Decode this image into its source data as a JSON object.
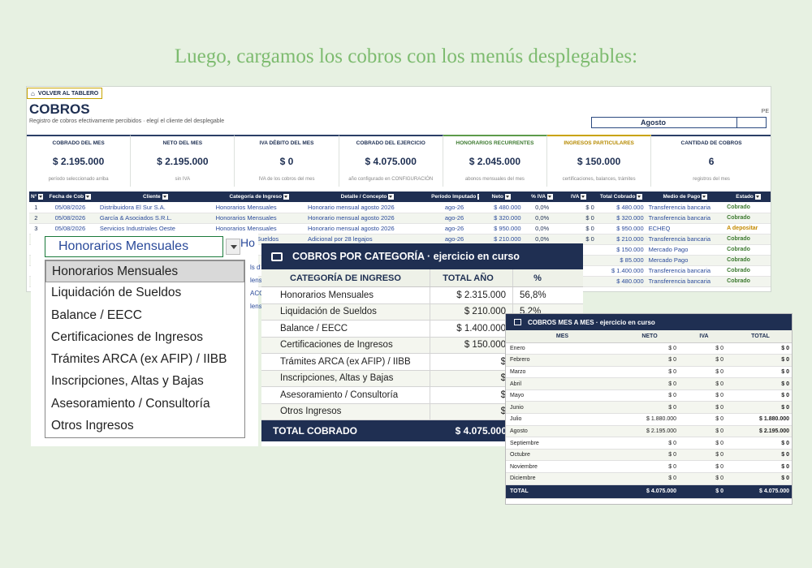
{
  "headline": "Luego, cargamos los cobros con los menús desplegables:",
  "sheet": {
    "back_label": "VOLVER AL TABLERO",
    "title": "COBROS",
    "subtitle": "Registro de cobros efectivamente percibidos  ·  elegí el cliente del desplegable",
    "period_label": "PE",
    "month": "Agosto"
  },
  "kpis": [
    {
      "label": "COBRADO DEL MES",
      "value": "$ 2.195.000",
      "sub": "período seleccionado arriba",
      "tone": "navy"
    },
    {
      "label": "NETO DEL MES",
      "value": "$ 2.195.000",
      "sub": "sin IVA",
      "tone": "navy"
    },
    {
      "label": "IVA DÉBITO DEL MES",
      "value": "$ 0",
      "sub": "IVA de los cobros del mes",
      "tone": "navy"
    },
    {
      "label": "COBRADO DEL EJERCICIO",
      "value": "$ 4.075.000",
      "sub": "año configurado en CONFIGURACIÓN",
      "tone": "navy"
    },
    {
      "label": "HONORARIOS RECURRENTES",
      "value": "$ 2.045.000",
      "sub": "abonos mensuales del mes",
      "tone": "green"
    },
    {
      "label": "INGRESOS PARTICULARES",
      "value": "$ 150.000",
      "sub": "certificaciones, balances, trámites",
      "tone": "gold"
    },
    {
      "label": "CANTIDAD DE COBROS",
      "value": "6",
      "sub": "registros del mes",
      "tone": "navy"
    }
  ],
  "table": {
    "headers": [
      "N°",
      "Fecha de Cob",
      "Cliente",
      "Categoría de Ingreso",
      "Detalle / Concepto",
      "Período Imputado",
      "Neto",
      "% IVA",
      "IVA",
      "Total Cobrado",
      "Medio de Pago",
      "Estado"
    ],
    "rows": [
      [
        "1",
        "05/08/2026",
        "Distribuidora El Sur S.A.",
        "Honorarios Mensuales",
        "Honorario mensual agosto 2026",
        "ago-26",
        "$ 480.000",
        "0,0%",
        "$ 0",
        "$ 480.000",
        "Transferencia bancaria",
        "Cobrado"
      ],
      [
        "2",
        "05/08/2026",
        "García & Asociados S.R.L.",
        "Honorarios Mensuales",
        "Honorario mensual agosto 2026",
        "ago-26",
        "$ 320.000",
        "0,0%",
        "$ 0",
        "$ 320.000",
        "Transferencia bancaria",
        "Cobrado"
      ],
      [
        "3",
        "05/08/2026",
        "Servicios Industriales Oeste",
        "Honorarios Mensuales",
        "Honorario mensual agosto 2026",
        "ago-26",
        "$ 950.000",
        "0,0%",
        "$ 0",
        "$ 950.000",
        "ECHEQ",
        "A depositar"
      ],
      [
        "4",
        "",
        "",
        "Liquidación de Sueldos",
        "Adicional por 28 legajos",
        "ago-26",
        "$ 210.000",
        "0,0%",
        "$ 0",
        "$ 210.000",
        "Transferencia bancaria",
        "Cobrado"
      ],
      [
        "5",
        "",
        "",
        "",
        "",
        "",
        "",
        "",
        "",
        "$ 150.000",
        "Mercado Pago",
        "Cobrado"
      ],
      [
        "6",
        "",
        "",
        "",
        "",
        "",
        "",
        "",
        "",
        "$ 85.000",
        "Mercado Pago",
        "Cobrado"
      ],
      [
        "7",
        "",
        "",
        "",
        "",
        "",
        "",
        "",
        "",
        "$ 1.400.000",
        "Transferencia bancaria",
        "Cobrado"
      ],
      [
        "8",
        "",
        "",
        "",
        "",
        "",
        "",
        "",
        "",
        "$ 480.000",
        "Transferencia bancaria",
        "Cobrado"
      ]
    ]
  },
  "dropdown": {
    "current": "Honorarios Mensuales",
    "peek": "Ho",
    "side_peeks": [
      "ls d",
      "lens",
      "ACC",
      "lens"
    ],
    "options": [
      "Honorarios Mensuales",
      "Liquidación de Sueldos",
      "Balance / EECC",
      "Certificaciones de Ingresos",
      "Trámites ARCA (ex AFIP) / IIBB",
      "Inscripciones, Altas y Bajas",
      "Asesoramiento / Consultoría",
      "Otros Ingresos"
    ]
  },
  "categoria": {
    "title": "COBROS POR CATEGORÍA  ·  ejercicio en curso",
    "col_categoria": "CATEGORÍA DE INGRESO",
    "col_total": "TOTAL AÑO",
    "col_pct": "%",
    "rows": [
      {
        "name": "Honorarios Mensuales",
        "total": "$ 2.315.000",
        "pct": "56,8%"
      },
      {
        "name": "Liquidación de Sueldos",
        "total": "$ 210.000",
        "pct": "5,2%"
      },
      {
        "name": "Balance / EECC",
        "total": "$ 1.400.000",
        "pct": ""
      },
      {
        "name": "Certificaciones de Ingresos",
        "total": "$ 150.000",
        "pct": ""
      },
      {
        "name": "Trámites ARCA (ex AFIP) / IIBB",
        "total": "$",
        "pct": ""
      },
      {
        "name": "Inscripciones, Altas y Bajas",
        "total": "$",
        "pct": ""
      },
      {
        "name": "Asesoramiento / Consultoría",
        "total": "$",
        "pct": ""
      },
      {
        "name": "Otros Ingresos",
        "total": "$",
        "pct": ""
      }
    ],
    "total_label": "TOTAL COBRADO",
    "total_value": "$ 4.075.000"
  },
  "mes": {
    "title": "COBROS MES A MES  ·  ejercicio en curso",
    "headers": [
      "MES",
      "NETO",
      "IVA",
      "TOTAL"
    ],
    "rows": [
      [
        "Enero",
        "$ 0",
        "$ 0",
        "$ 0"
      ],
      [
        "Febrero",
        "$ 0",
        "$ 0",
        "$ 0"
      ],
      [
        "Marzo",
        "$ 0",
        "$ 0",
        "$ 0"
      ],
      [
        "Abril",
        "$ 0",
        "$ 0",
        "$ 0"
      ],
      [
        "Mayo",
        "$ 0",
        "$ 0",
        "$ 0"
      ],
      [
        "Junio",
        "$ 0",
        "$ 0",
        "$ 0"
      ],
      [
        "Julio",
        "$ 1.880.000",
        "$ 0",
        "$ 1.880.000"
      ],
      [
        "Agosto",
        "$ 2.195.000",
        "$ 0",
        "$ 2.195.000"
      ],
      [
        "Septiembre",
        "$ 0",
        "$ 0",
        "$ 0"
      ],
      [
        "Octubre",
        "$ 0",
        "$ 0",
        "$ 0"
      ],
      [
        "Noviembre",
        "$ 0",
        "$ 0",
        "$ 0"
      ],
      [
        "Diciembre",
        "$ 0",
        "$ 0",
        "$ 0"
      ]
    ],
    "total": [
      "TOTAL",
      "$ 4.075.000",
      "$ 0",
      "$ 4.075.000"
    ]
  }
}
